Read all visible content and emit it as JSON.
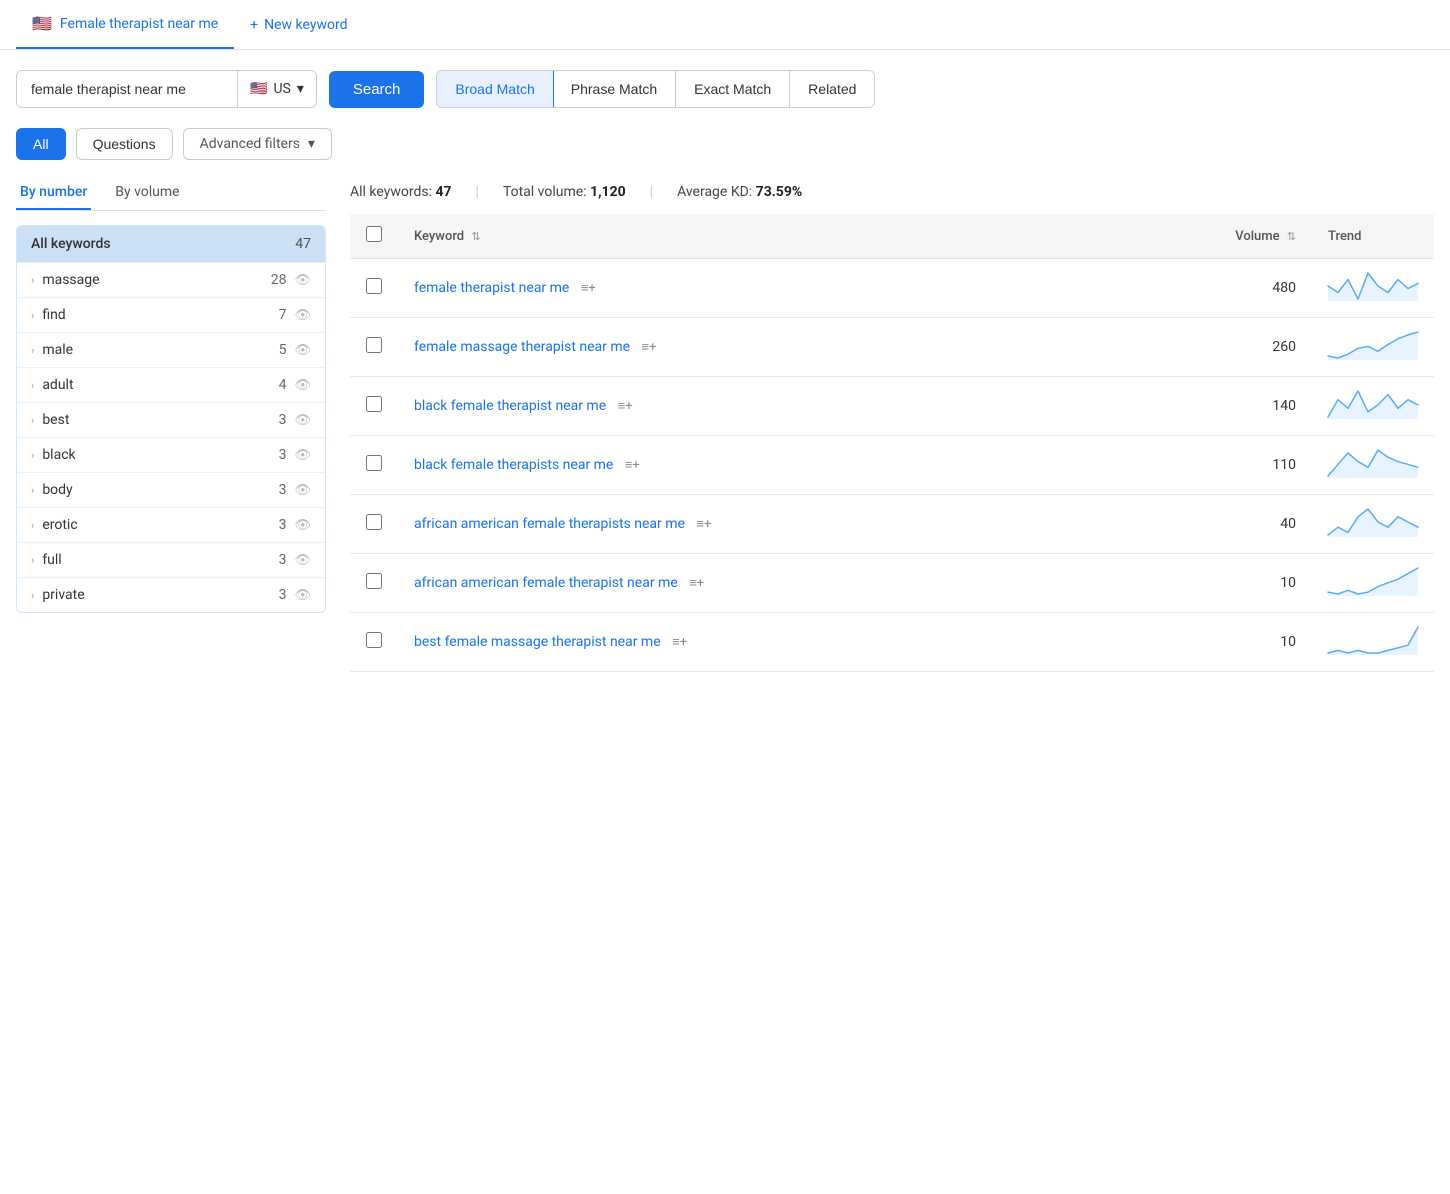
{
  "tabs": [
    {
      "id": "main",
      "label": "Female therapist near me",
      "flag": "🇺🇸",
      "active": true
    },
    {
      "id": "new",
      "label": "New keyword",
      "isNew": true
    }
  ],
  "search": {
    "value": "female therapist near me",
    "country": "US",
    "flag": "🇺🇸",
    "button_label": "Search",
    "chevron": "▾"
  },
  "match_tabs": [
    {
      "id": "broad",
      "label": "Broad Match",
      "active": true
    },
    {
      "id": "phrase",
      "label": "Phrase Match",
      "active": false
    },
    {
      "id": "exact",
      "label": "Exact Match",
      "active": false
    },
    {
      "id": "related",
      "label": "Related",
      "active": false
    }
  ],
  "filters": {
    "all_label": "All",
    "questions_label": "Questions",
    "advanced_label": "Advanced filters",
    "chevron": "▾"
  },
  "sort_tabs": [
    {
      "id": "number",
      "label": "By number",
      "active": true
    },
    {
      "id": "volume",
      "label": "By volume",
      "active": false
    }
  ],
  "stats": {
    "all_keywords_label": "All keywords:",
    "all_keywords_value": "47",
    "total_volume_label": "Total volume:",
    "total_volume_value": "1,120",
    "avg_kd_label": "Average KD:",
    "avg_kd_value": "73.59%"
  },
  "sidebar": {
    "header_label": "All keywords",
    "header_count": "47",
    "items": [
      {
        "word": "massage",
        "count": "28"
      },
      {
        "word": "find",
        "count": "7"
      },
      {
        "word": "male",
        "count": "5"
      },
      {
        "word": "adult",
        "count": "4"
      },
      {
        "word": "best",
        "count": "3"
      },
      {
        "word": "black",
        "count": "3"
      },
      {
        "word": "body",
        "count": "3"
      },
      {
        "word": "erotic",
        "count": "3"
      },
      {
        "word": "full",
        "count": "3"
      },
      {
        "word": "private",
        "count": "3"
      }
    ]
  },
  "table": {
    "col_keyword": "Keyword",
    "col_volume": "Volume",
    "col_trend": "Trend",
    "rows": [
      {
        "keyword": "female therapist near me",
        "volume": "480",
        "trend": [
          30,
          25,
          35,
          20,
          40,
          30,
          25,
          35,
          28,
          32
        ]
      },
      {
        "keyword": "female massage therapist near me",
        "volume": "260",
        "trend": [
          20,
          18,
          22,
          28,
          30,
          25,
          32,
          38,
          42,
          45
        ]
      },
      {
        "keyword": "black female therapist near me",
        "volume": "140",
        "trend": [
          15,
          25,
          20,
          30,
          18,
          22,
          28,
          20,
          25,
          22
        ]
      },
      {
        "keyword": "black female therapists near me",
        "volume": "110",
        "trend": [
          12,
          20,
          28,
          22,
          18,
          30,
          25,
          22,
          20,
          18
        ]
      },
      {
        "keyword": "african american female therapists near me",
        "volume": "40",
        "trend": [
          5,
          8,
          6,
          12,
          15,
          10,
          8,
          12,
          10,
          8
        ]
      },
      {
        "keyword": "african american female therapist near me",
        "volume": "10",
        "trend": [
          5,
          4,
          6,
          4,
          5,
          8,
          10,
          12,
          15,
          18
        ]
      },
      {
        "keyword": "best female massage therapist near me",
        "volume": "10",
        "trend": [
          2,
          3,
          2,
          3,
          2,
          2,
          3,
          4,
          5,
          12
        ]
      }
    ]
  },
  "icons": {
    "chevron_right": "›",
    "eye": "👁",
    "plus": "+",
    "sort": "⇅",
    "add_to_list": "≡+"
  }
}
